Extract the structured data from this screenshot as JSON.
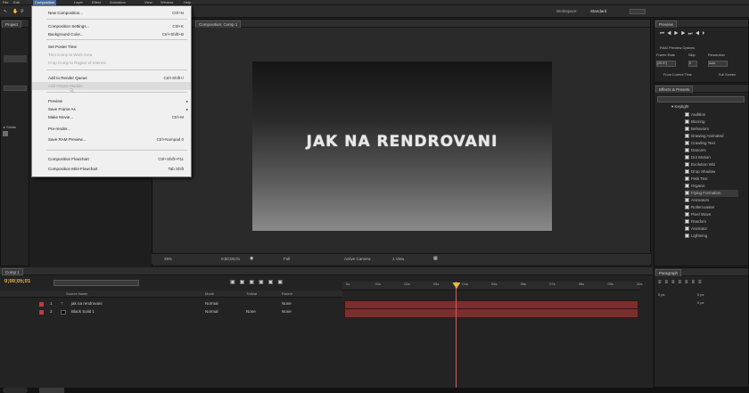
{
  "menubar": {
    "items": [
      "File",
      "Edit",
      "Composition",
      "Layer",
      "Effect",
      "Animation",
      "View",
      "Window",
      "Help"
    ]
  },
  "toolbar": {
    "workspace_label": "Workspace:",
    "workspace_value": "Standard"
  },
  "composition_menu": {
    "items": [
      {
        "label": "New Composition...",
        "shortcut": "Ctrl+N",
        "state": "normal"
      },
      {
        "label": "Composition Settings...",
        "shortcut": "Ctrl+K",
        "state": "normal"
      },
      {
        "label": "Background Color...",
        "shortcut": "Ctrl+Shift+B",
        "state": "normal"
      },
      {
        "label": "Set Poster Time",
        "shortcut": "",
        "state": "normal"
      },
      {
        "label": "Trim Comp to Work Area",
        "shortcut": "",
        "state": "disabled"
      },
      {
        "label": "Crop Comp to Region of Interest",
        "shortcut": "",
        "state": "disabled"
      },
      {
        "label": "Add to Render Queue",
        "shortcut": "Ctrl+Shift+/",
        "state": "normal"
      },
      {
        "label": "Add Output Module",
        "shortcut": "",
        "state": "disabled"
      },
      {
        "label": "Preview",
        "shortcut": "",
        "state": "submenu"
      },
      {
        "label": "Save Frame As",
        "shortcut": "",
        "state": "submenu"
      },
      {
        "label": "Make Movie...",
        "shortcut": "Ctrl+M",
        "state": "normal"
      },
      {
        "label": "Pre-render...",
        "shortcut": "",
        "state": "normal"
      },
      {
        "label": "Save RAM Preview...",
        "shortcut": "Ctrl+Numpad 0",
        "state": "normal"
      },
      {
        "label": "Composition Flowchart",
        "shortcut": "Ctrl+Shift+F11",
        "state": "normal"
      },
      {
        "label": "Composition Mini-Flowchart",
        "shortcut": "Tab Shift",
        "state": "normal"
      }
    ]
  },
  "project_panel": {
    "tab": "Project",
    "folder_label": "Solids"
  },
  "viewer": {
    "tab": "Composition: Comp 1",
    "comp_title": "JAK NA RENDROVANI",
    "zoom": "25%",
    "timecode": "0;00;05;01",
    "resolution": "Full",
    "camera": "Active Camera",
    "views": "1 View"
  },
  "preview_panel": {
    "tab": "Preview",
    "ram_label": "RAM Preview Options",
    "framerate_label": "Frame Rate",
    "skip_label": "Skip",
    "resolution_label": "Resolution",
    "framerate_value": "(29.97)",
    "skip_value": "0",
    "resolution_value": "Auto",
    "from_current": "From Current Time",
    "full_screen": "Full Screen"
  },
  "effects_panel": {
    "tab": "Effects & Presets",
    "folder": "Keylight",
    "items": [
      "Audition",
      "Blurring",
      "Behaviors",
      "Drawing Animated",
      "Crawling Text",
      "Dancers",
      "Dot Motion",
      "Evolution Wiz",
      "Drop Shadow",
      "Path Text",
      "Organic",
      "Flying Formation",
      "Animators",
      "Rollercoaster",
      "Pixel Wave",
      "Random",
      "Animator",
      "Lightning"
    ]
  },
  "paragraph_panel": {
    "tab": "Paragraph",
    "indent_a": "0 px",
    "indent_b": "0 px",
    "indent_c": "0 px"
  },
  "timeline": {
    "tab": "Comp 1",
    "timecode": "0;00;05;01",
    "columns": {
      "source": "Source Name",
      "mode": "Mode",
      "trkmat": "TrkMat",
      "parent": "Parent"
    },
    "layers": [
      {
        "num": "1",
        "name": "jak na rendrovani",
        "mode": "Normal",
        "trkmat": "",
        "parent": "None"
      },
      {
        "num": "2",
        "name": "Black Solid 1",
        "mode": "Normal",
        "trkmat": "None",
        "parent": "None"
      }
    ],
    "ruler": [
      "0s",
      "01s",
      "02s",
      "03s",
      "04s",
      "05s",
      "06s",
      "07s",
      "08s",
      "09s",
      "10s"
    ],
    "current_time_fraction": 0.38
  }
}
